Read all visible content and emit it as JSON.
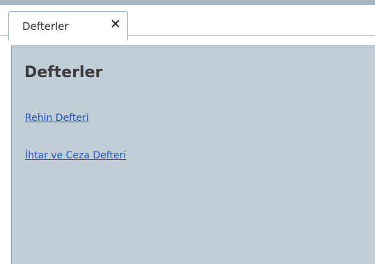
{
  "tab": {
    "label": "Defterler",
    "close_glyph": "✕",
    "close_icon": "close-icon"
  },
  "page": {
    "title": "Defterler"
  },
  "links": [
    {
      "label": "Rehin Defteri"
    },
    {
      "label": "İhtar ve Ceza Defteri"
    }
  ],
  "colors": {
    "content_background": "#c1ced7",
    "link": "#1f57c7",
    "tab_border": "#8fb2cc"
  }
}
